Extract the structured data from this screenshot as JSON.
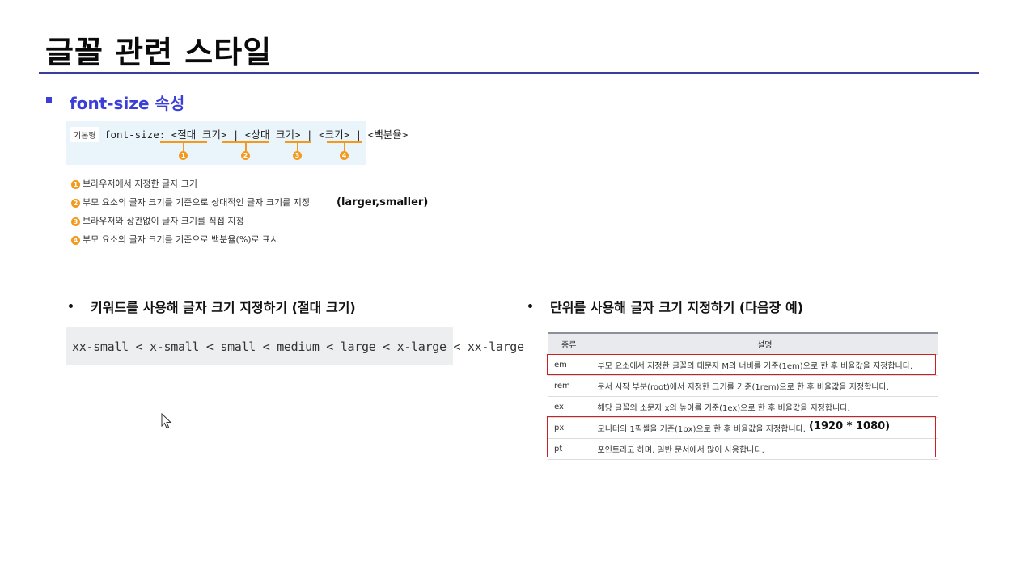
{
  "page": {
    "title": "글꼴 관련 스타일",
    "section_title": "font-size 속성"
  },
  "syntax": {
    "tag": "기본형",
    "line": "font-size: <절대 크기> | <상대 크기> | <크기> | <백분율>",
    "markers": [
      "1",
      "2",
      "3",
      "4"
    ]
  },
  "descriptions": [
    {
      "num": "1",
      "text": "브라우저에서 지정한 글자 크기"
    },
    {
      "num": "2",
      "text": "부모 요소의 글자 크기를 기준으로 상대적인 글자 크기를 지정"
    },
    {
      "num": "3",
      "text": "브라우저와 상관없이 글자 크기를 직접 지정"
    },
    {
      "num": "4",
      "text": "부모 요소의 글자 크기를 기준으로 백분율(%)로 표시"
    }
  ],
  "relative_note": "(larger,smaller)",
  "keyword_section": {
    "heading": "키워드를 사용해 글자 크기 지정하기 (절대 크기)",
    "keywords": "xx-small < x-small < small < medium < large < x-large < xx-large"
  },
  "unit_section": {
    "heading": "단위를 사용해 글자 크기 지정하기 (다음장 예)",
    "headers": [
      "종류",
      "설명"
    ],
    "rows": [
      {
        "unit": "em",
        "desc": "부모 요소에서 지정한 글꼴의 대문자 M의 너비를 기준(1em)으로 한 후 비율값을 지정합니다."
      },
      {
        "unit": "rem",
        "desc": "문서 시작 부분(root)에서 지정한 크기를 기준(1rem)으로 한 후 비율값을 지정합니다."
      },
      {
        "unit": "ex",
        "desc": "해당 글꼴의 소문자 x의 높이를 기준(1ex)으로 한 후 비율값을 지정합니다."
      },
      {
        "unit": "px",
        "desc": "모니터의 1픽셀을 기준(1px)으로 한 후 비율값을 지정합니다."
      },
      {
        "unit": "pt",
        "desc": "포인트라고 하며, 일반 문서에서 많이 사용합니다."
      }
    ],
    "resolution_note": "(1920 * 1080)"
  },
  "colors": {
    "accent": "#3b3fd8",
    "rule": "#3a3d9a",
    "marker": "#f39a1c",
    "highlight": "#cc2020"
  }
}
